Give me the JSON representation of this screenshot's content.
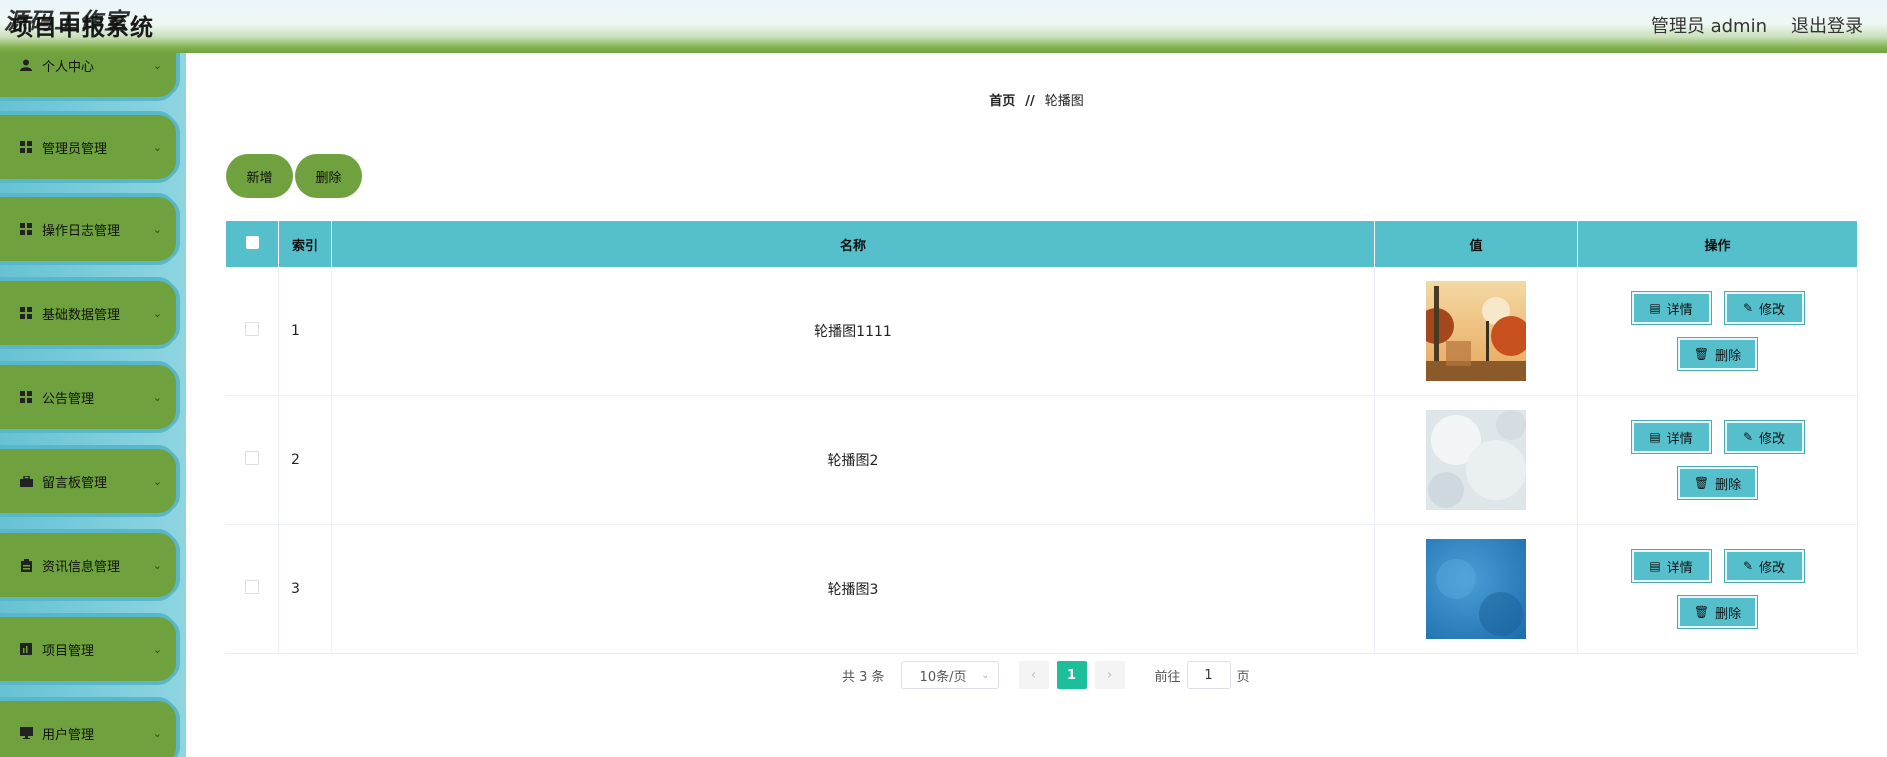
{
  "header": {
    "title": "项目申报系统",
    "watermark": "源码工作室",
    "admin_label": "管理员 admin",
    "logout_label": "退出登录"
  },
  "sidebar": {
    "items": [
      {
        "label": "个人中心",
        "icon": "user-icon"
      },
      {
        "label": "管理员管理",
        "icon": "grid-icon"
      },
      {
        "label": "操作日志管理",
        "icon": "grid-icon"
      },
      {
        "label": "基础数据管理",
        "icon": "grid-icon"
      },
      {
        "label": "公告管理",
        "icon": "grid-icon"
      },
      {
        "label": "留言板管理",
        "icon": "briefcase-icon"
      },
      {
        "label": "资讯信息管理",
        "icon": "clipboard-icon"
      },
      {
        "label": "项目管理",
        "icon": "chart-icon"
      },
      {
        "label": "用户管理",
        "icon": "monitor-icon"
      }
    ]
  },
  "breadcrumb": {
    "home": "首页",
    "separator": "//",
    "current": "轮播图"
  },
  "toolbar": {
    "add_label": "新增",
    "delete_label": "删除"
  },
  "table": {
    "headers": {
      "index": "索引",
      "name": "名称",
      "value": "值",
      "actions": "操作"
    },
    "rows": [
      {
        "index": "1",
        "name": "轮播图1111",
        "thumb": "autumn-street-image"
      },
      {
        "index": "2",
        "name": "轮播图2",
        "thumb": "pale-cloud-image"
      },
      {
        "index": "3",
        "name": "轮播图3",
        "thumb": "blue-texture-image"
      }
    ],
    "row_actions": {
      "detail": "详情",
      "edit": "修改",
      "delete": "删除"
    }
  },
  "pagination": {
    "total": "共 3 条",
    "page_size": "10条/页",
    "current_page": "1",
    "goto_prefix": "前往",
    "goto_value": "1",
    "goto_suffix": "页"
  },
  "colors": {
    "accent_green": "#6fa23e",
    "teal": "#55bfcc",
    "page_active": "#1dbf9a"
  }
}
